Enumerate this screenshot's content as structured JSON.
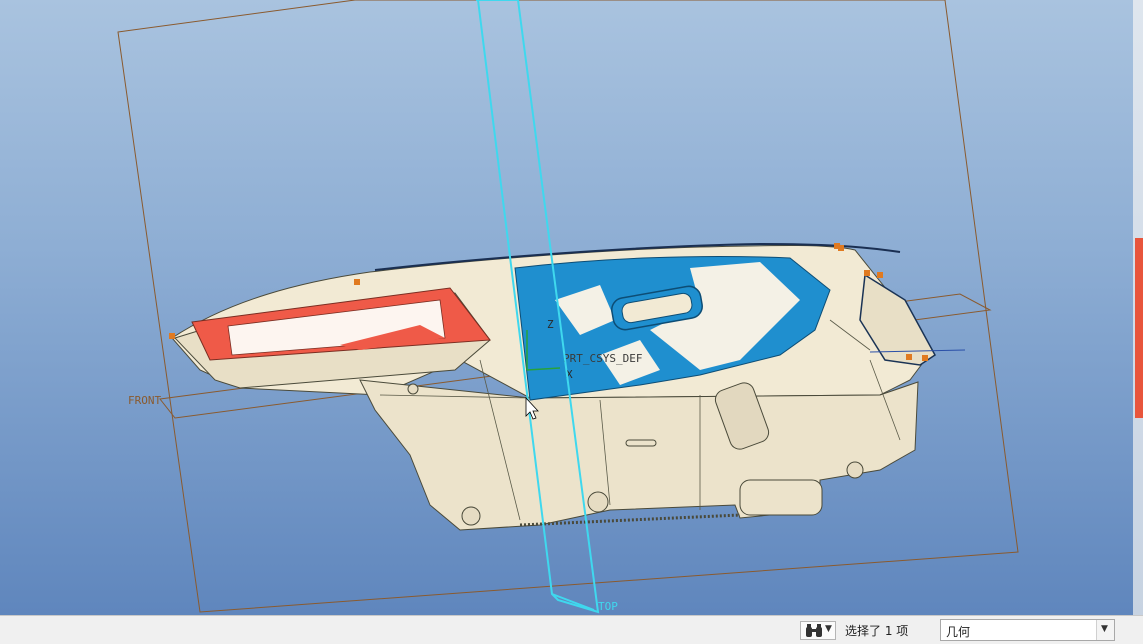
{
  "viewport": {
    "datum_planes": [
      "FRONT",
      "TOP"
    ],
    "coordinate_system": "PRT_CSYS_DEF",
    "axes": [
      "Z",
      "X"
    ],
    "background_top": "#a9c3df",
    "background_bottom": "#5f86bd"
  },
  "status_bar": {
    "find_icon": "binoculars-icon",
    "selection_text": "选择了 1 项",
    "filter_value": "几何"
  },
  "colors": {
    "plane_outline": "#8a5a2e",
    "selected_plane": "#3fd8ee",
    "model_body": "#f2ead4",
    "surface_blue": "#1f8fcf",
    "surface_red": "#ef5a48"
  }
}
